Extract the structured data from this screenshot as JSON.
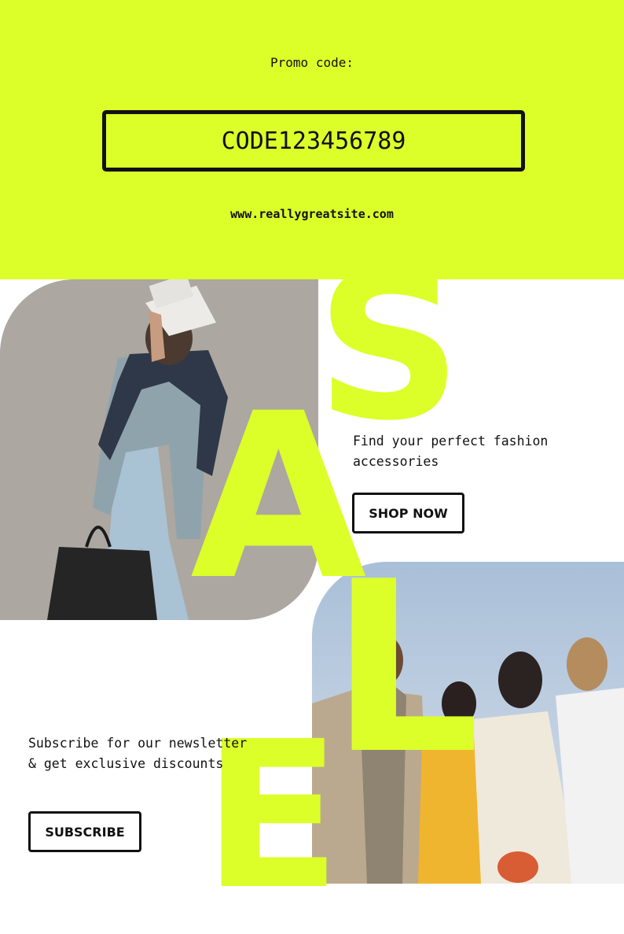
{
  "promo": {
    "label": "Promo code:",
    "code": "CODE123456789",
    "website": "www.reallygreatsite.com"
  },
  "sale_letters": [
    "S",
    "A",
    "L",
    "E"
  ],
  "shop": {
    "tagline": "Find your perfect fashion accessories",
    "button_label": "SHOP NOW"
  },
  "newsletter": {
    "text": "Subscribe for our newsletter & get exclusive discounts",
    "button_label": "SUBSCRIBE"
  },
  "colors": {
    "accent": "#dcff2a",
    "ink": "#111111",
    "background": "#ffffff"
  }
}
